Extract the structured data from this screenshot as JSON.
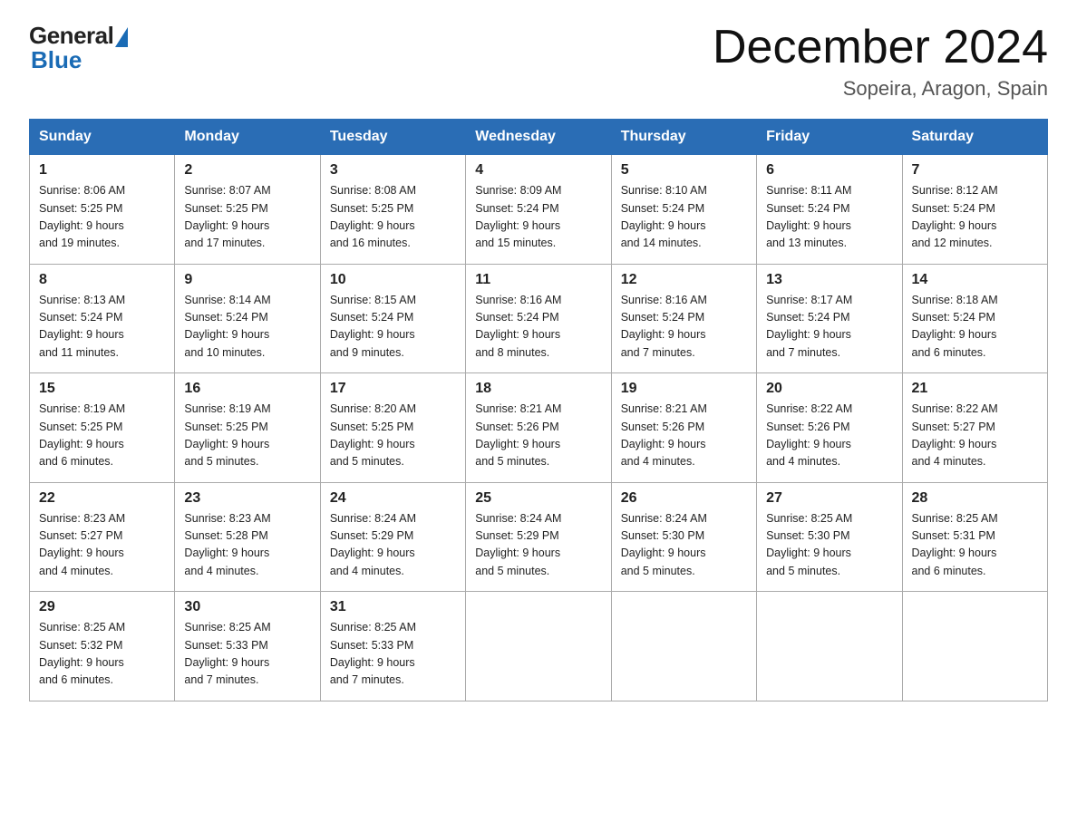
{
  "logo": {
    "general": "General",
    "blue": "Blue"
  },
  "title": "December 2024",
  "subtitle": "Sopeira, Aragon, Spain",
  "weekdays": [
    "Sunday",
    "Monday",
    "Tuesday",
    "Wednesday",
    "Thursday",
    "Friday",
    "Saturday"
  ],
  "weeks": [
    [
      {
        "day": "1",
        "info": "Sunrise: 8:06 AM\nSunset: 5:25 PM\nDaylight: 9 hours\nand 19 minutes."
      },
      {
        "day": "2",
        "info": "Sunrise: 8:07 AM\nSunset: 5:25 PM\nDaylight: 9 hours\nand 17 minutes."
      },
      {
        "day": "3",
        "info": "Sunrise: 8:08 AM\nSunset: 5:25 PM\nDaylight: 9 hours\nand 16 minutes."
      },
      {
        "day": "4",
        "info": "Sunrise: 8:09 AM\nSunset: 5:24 PM\nDaylight: 9 hours\nand 15 minutes."
      },
      {
        "day": "5",
        "info": "Sunrise: 8:10 AM\nSunset: 5:24 PM\nDaylight: 9 hours\nand 14 minutes."
      },
      {
        "day": "6",
        "info": "Sunrise: 8:11 AM\nSunset: 5:24 PM\nDaylight: 9 hours\nand 13 minutes."
      },
      {
        "day": "7",
        "info": "Sunrise: 8:12 AM\nSunset: 5:24 PM\nDaylight: 9 hours\nand 12 minutes."
      }
    ],
    [
      {
        "day": "8",
        "info": "Sunrise: 8:13 AM\nSunset: 5:24 PM\nDaylight: 9 hours\nand 11 minutes."
      },
      {
        "day": "9",
        "info": "Sunrise: 8:14 AM\nSunset: 5:24 PM\nDaylight: 9 hours\nand 10 minutes."
      },
      {
        "day": "10",
        "info": "Sunrise: 8:15 AM\nSunset: 5:24 PM\nDaylight: 9 hours\nand 9 minutes."
      },
      {
        "day": "11",
        "info": "Sunrise: 8:16 AM\nSunset: 5:24 PM\nDaylight: 9 hours\nand 8 minutes."
      },
      {
        "day": "12",
        "info": "Sunrise: 8:16 AM\nSunset: 5:24 PM\nDaylight: 9 hours\nand 7 minutes."
      },
      {
        "day": "13",
        "info": "Sunrise: 8:17 AM\nSunset: 5:24 PM\nDaylight: 9 hours\nand 7 minutes."
      },
      {
        "day": "14",
        "info": "Sunrise: 8:18 AM\nSunset: 5:24 PM\nDaylight: 9 hours\nand 6 minutes."
      }
    ],
    [
      {
        "day": "15",
        "info": "Sunrise: 8:19 AM\nSunset: 5:25 PM\nDaylight: 9 hours\nand 6 minutes."
      },
      {
        "day": "16",
        "info": "Sunrise: 8:19 AM\nSunset: 5:25 PM\nDaylight: 9 hours\nand 5 minutes."
      },
      {
        "day": "17",
        "info": "Sunrise: 8:20 AM\nSunset: 5:25 PM\nDaylight: 9 hours\nand 5 minutes."
      },
      {
        "day": "18",
        "info": "Sunrise: 8:21 AM\nSunset: 5:26 PM\nDaylight: 9 hours\nand 5 minutes."
      },
      {
        "day": "19",
        "info": "Sunrise: 8:21 AM\nSunset: 5:26 PM\nDaylight: 9 hours\nand 4 minutes."
      },
      {
        "day": "20",
        "info": "Sunrise: 8:22 AM\nSunset: 5:26 PM\nDaylight: 9 hours\nand 4 minutes."
      },
      {
        "day": "21",
        "info": "Sunrise: 8:22 AM\nSunset: 5:27 PM\nDaylight: 9 hours\nand 4 minutes."
      }
    ],
    [
      {
        "day": "22",
        "info": "Sunrise: 8:23 AM\nSunset: 5:27 PM\nDaylight: 9 hours\nand 4 minutes."
      },
      {
        "day": "23",
        "info": "Sunrise: 8:23 AM\nSunset: 5:28 PM\nDaylight: 9 hours\nand 4 minutes."
      },
      {
        "day": "24",
        "info": "Sunrise: 8:24 AM\nSunset: 5:29 PM\nDaylight: 9 hours\nand 4 minutes."
      },
      {
        "day": "25",
        "info": "Sunrise: 8:24 AM\nSunset: 5:29 PM\nDaylight: 9 hours\nand 5 minutes."
      },
      {
        "day": "26",
        "info": "Sunrise: 8:24 AM\nSunset: 5:30 PM\nDaylight: 9 hours\nand 5 minutes."
      },
      {
        "day": "27",
        "info": "Sunrise: 8:25 AM\nSunset: 5:30 PM\nDaylight: 9 hours\nand 5 minutes."
      },
      {
        "day": "28",
        "info": "Sunrise: 8:25 AM\nSunset: 5:31 PM\nDaylight: 9 hours\nand 6 minutes."
      }
    ],
    [
      {
        "day": "29",
        "info": "Sunrise: 8:25 AM\nSunset: 5:32 PM\nDaylight: 9 hours\nand 6 minutes."
      },
      {
        "day": "30",
        "info": "Sunrise: 8:25 AM\nSunset: 5:33 PM\nDaylight: 9 hours\nand 7 minutes."
      },
      {
        "day": "31",
        "info": "Sunrise: 8:25 AM\nSunset: 5:33 PM\nDaylight: 9 hours\nand 7 minutes."
      },
      {
        "day": "",
        "info": ""
      },
      {
        "day": "",
        "info": ""
      },
      {
        "day": "",
        "info": ""
      },
      {
        "day": "",
        "info": ""
      }
    ]
  ]
}
